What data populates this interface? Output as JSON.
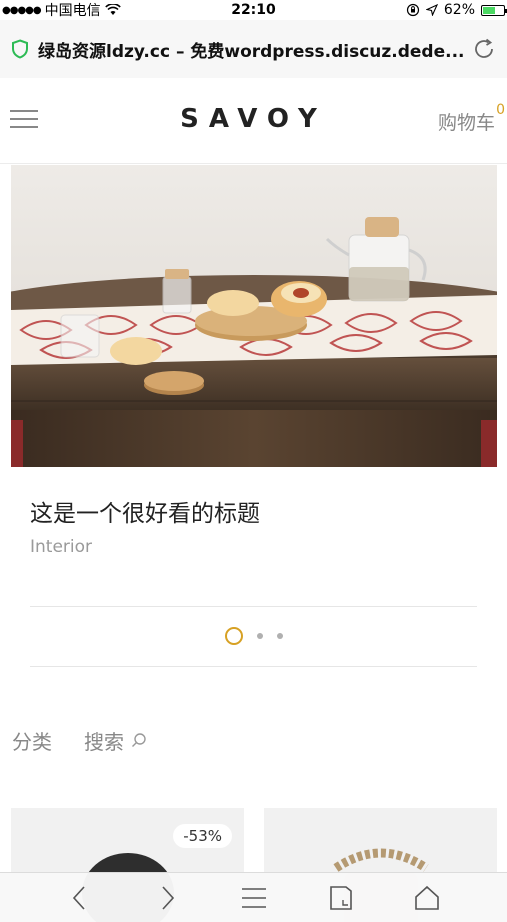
{
  "status_bar": {
    "carrier_dots": "●●●●●",
    "carrier": "中国电信",
    "wifi_icon": "wifi-icon",
    "time": "22:10",
    "battery_percent": "62%",
    "battery_level": 0.62
  },
  "browser": {
    "url": "绿岛资源ldzy.cc – 免费wordpress.discuz.dede...",
    "secure_icon": "shield-icon",
    "reload_icon": "reload-icon"
  },
  "site_header": {
    "logo": "SAVOY",
    "cart_label": "购物车",
    "cart_count": "0",
    "accent_color": "#d7a124"
  },
  "post": {
    "title": "这是一个很好看的标题",
    "category": "Interior"
  },
  "slider": {
    "total": 3,
    "active_index": 0
  },
  "filter": {
    "category_label": "分类",
    "search_label": "搜索"
  },
  "products": [
    {
      "badge": "-53%"
    },
    {
      "badge": ""
    }
  ],
  "toolbar": {
    "icons": [
      "back-icon",
      "forward-icon",
      "menu-icon",
      "tabs-icon",
      "home-icon"
    ]
  }
}
